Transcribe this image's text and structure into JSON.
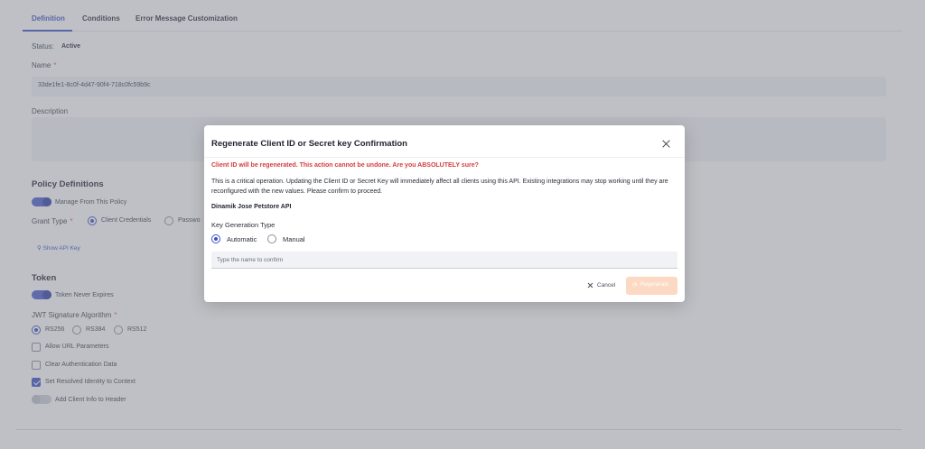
{
  "tabs": [
    "Definition",
    "Conditions",
    "Error Message Customization"
  ],
  "status": {
    "label": "Status:",
    "value": "Active"
  },
  "name": {
    "label": "Name",
    "required": "*",
    "value": "33de1fe1-8c0f-4d47-90f4-718c0fc59b9c"
  },
  "description": {
    "label": "Description",
    "value": ""
  },
  "policy_definitions": {
    "heading": "Policy Definitions",
    "manage_toggle_label": "Manage From This Policy",
    "grant_type_label": "Grant Type",
    "grant_type_required": "*",
    "grant_options": [
      "Client Credentials",
      "Passwo"
    ],
    "show_api_key": "Show API Key"
  },
  "token": {
    "heading": "Token",
    "never_expires_label": "Token Never Expires",
    "jwt_label": "JWT Signature Algorithm",
    "jwt_required": "*",
    "algorithms": [
      "RS256",
      "RS384",
      "RS512"
    ],
    "checkboxes": [
      "Allow URL Parameters",
      "Clear Authentication Data",
      "Set Resolved Identity to Context"
    ],
    "client_info_label": "Add Client Info to Header"
  },
  "modal": {
    "title": "Regenerate Client ID or Secret key Confirmation",
    "warning": "Client ID will be regenerated. This action cannot be undone. Are you ABSOLUTELY sure?",
    "description": "This is a critical operation. Updating the Client ID or Secret Key will immediately affect all clients using this API. Existing integrations may stop working until they are reconfigured with the new values. Please confirm to proceed.",
    "api_name": "Dinamik Jose Petstore API",
    "key_gen_label": "Key Generation Type",
    "key_gen_options": [
      "Automatic",
      "Manual"
    ],
    "confirm_placeholder": "Type the name to confirm",
    "cancel_label": "Cancel",
    "regenerate_label": "Regenerate"
  },
  "colors": {
    "accent": "#3d52c4",
    "warning": "#d63b3b",
    "regenerate_disabled": "#fbd9c2"
  }
}
